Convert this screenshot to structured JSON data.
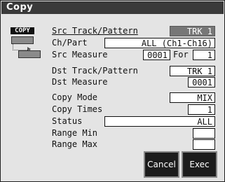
{
  "window": {
    "title": "Copy"
  },
  "icon": {
    "label": "COPY"
  },
  "fields": {
    "src_track": {
      "label": "Src Track/Pattern",
      "value": "TRK 1"
    },
    "ch_part": {
      "label": "Ch/Part",
      "value": "ALL (Ch1-Ch16)"
    },
    "src_measure": {
      "label": "Src Measure",
      "value": "0001",
      "for_label": "For",
      "for_value": "1"
    },
    "dst_track": {
      "label": "Dst Track/Pattern",
      "value": "TRK 1"
    },
    "dst_measure": {
      "label": "Dst Measure",
      "value": "0001"
    },
    "copy_mode": {
      "label": "Copy Mode",
      "value": "MIX"
    },
    "copy_times": {
      "label": "Copy Times",
      "value": "1"
    },
    "status": {
      "label": "Status",
      "value": "ALL"
    },
    "range_min": {
      "label": "Range Min",
      "value": ""
    },
    "range_max": {
      "label": "Range Max",
      "value": ""
    }
  },
  "buttons": {
    "cancel": "Cancel",
    "exec": "Exec"
  }
}
